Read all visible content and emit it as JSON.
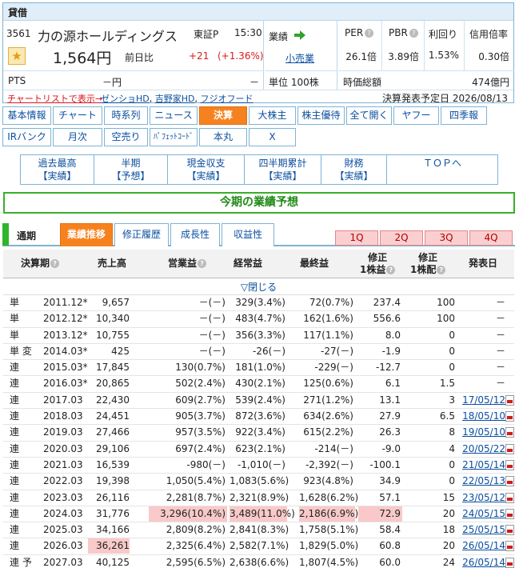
{
  "header": {
    "tag": "貸借",
    "code": "3561",
    "name": "力の源ホールディングス",
    "market": "東証P",
    "time": "15:30",
    "price": "1,564円",
    "diff_label": "前日比",
    "diff_value": "+21",
    "diff_pct": "(+1.36%)",
    "pts_label": "PTS",
    "pts_value": "－円",
    "pts_change": "－",
    "gyoseki_label": "業績",
    "sector": "小売業",
    "unit": "単位 100株",
    "indicators": [
      {
        "label": "PER",
        "value": "26.1倍"
      },
      {
        "label": "PBR",
        "value": "3.89倍"
      },
      {
        "label": "利回り",
        "value": "1.53%"
      },
      {
        "label": "信用倍率",
        "value": "0.30倍"
      }
    ],
    "market_cap_label": "時価総額",
    "market_cap_value": "474億円",
    "chart_list_link": "チャートリストで表示→",
    "related": [
      "ゼンショHD",
      "吉野家HD",
      "フジオフード"
    ],
    "announce": "決算発表予定日  2026/08/13"
  },
  "nav_row1": [
    "基本情報",
    "チャート",
    "時系列",
    "ニュース",
    "決算",
    "大株主",
    "株主優待",
    "全て開く",
    "ヤフー",
    "四季報"
  ],
  "nav_row2": [
    "IRバンク",
    "月次",
    "空売り",
    "ﾊﾟﾌｪｯﾄｺｰﾄﾞ",
    "本丸",
    "X"
  ],
  "submenu": [
    {
      "top": "過去最高",
      "bottom": "【実績】"
    },
    {
      "top": "半期",
      "bottom": "【予想】"
    },
    {
      "top": "現金収支",
      "bottom": "【実績】"
    },
    {
      "top": "四半期累計",
      "bottom": "【実績】"
    },
    {
      "top": "財務",
      "bottom": "【実績】"
    },
    {
      "top": "ＴＯＰへ",
      "bottom": ""
    }
  ],
  "section_title": "今期の業績予想",
  "tabs": {
    "period_label": "通期",
    "items": [
      "業績推移",
      "修正履歴",
      "成長性",
      "収益性"
    ],
    "quarters": [
      "1Q",
      "2Q",
      "3Q",
      "4Q"
    ]
  },
  "table": {
    "headers": {
      "period": "決算期",
      "sales": "売上高",
      "op": "営業益",
      "ord": "経常益",
      "net": "最終益",
      "eps1": "修正",
      "eps2": "1株益",
      "div1": "修正",
      "div2": "1株配",
      "date": "発表日"
    },
    "toggle": "▽閉じる",
    "rows": [
      {
        "kind": "単",
        "period": "2011.12*",
        "sales": "9,657",
        "op": "－(－)",
        "ord": "329(3.4%)",
        "net": "72(0.7%)",
        "eps": "237.4",
        "div": "100",
        "date": "－"
      },
      {
        "kind": "単",
        "period": "2012.12*",
        "sales": "10,340",
        "op": "－(－)",
        "ord": "483(4.7%)",
        "net": "162(1.6%)",
        "eps": "556.6",
        "div": "100",
        "date": "－"
      },
      {
        "kind": "単",
        "period": "2013.12*",
        "sales": "10,755",
        "op": "－(－)",
        "ord": "356(3.3%)",
        "net": "117(1.1%)",
        "eps": "8.0",
        "div": "0",
        "date": "－"
      },
      {
        "kind": "単 変",
        "period": "2014.03*",
        "sales": "425",
        "op": "－(－)",
        "ord": "-26(－)",
        "net": "-27(－)",
        "eps": "-1.9",
        "div": "0",
        "date": "－"
      },
      {
        "kind": "連",
        "period": "2015.03*",
        "sales": "17,845",
        "op": "130(0.7%)",
        "ord": "181(1.0%)",
        "net": "-229(－)",
        "eps": "-12.7",
        "div": "0",
        "date": "－"
      },
      {
        "kind": "連",
        "period": "2016.03*",
        "sales": "20,865",
        "op": "502(2.4%)",
        "ord": "430(2.1%)",
        "net": "125(0.6%)",
        "eps": "6.1",
        "div": "1.5",
        "date": "－"
      },
      {
        "kind": "連",
        "period": "2017.03",
        "sales": "22,430",
        "op": "609(2.7%)",
        "ord": "539(2.4%)",
        "net": "271(1.2%)",
        "eps": "13.1",
        "div": "3",
        "date": "17/05/12"
      },
      {
        "kind": "連",
        "period": "2018.03",
        "sales": "24,451",
        "op": "905(3.7%)",
        "ord": "872(3.6%)",
        "net": "634(2.6%)",
        "eps": "27.9",
        "div": "6.5",
        "date": "18/05/10"
      },
      {
        "kind": "連",
        "period": "2019.03",
        "sales": "27,466",
        "op": "957(3.5%)",
        "ord": "922(3.4%)",
        "net": "615(2.2%)",
        "eps": "26.3",
        "div": "8",
        "date": "19/05/10"
      },
      {
        "kind": "連",
        "period": "2020.03",
        "sales": "29,106",
        "op": "697(2.4%)",
        "ord": "623(2.1%)",
        "net": "-214(－)",
        "eps": "-9.0",
        "div": "4",
        "date": "20/05/22"
      },
      {
        "kind": "連",
        "period": "2021.03",
        "sales": "16,539",
        "op": "-980(－)",
        "ord": "-1,010(－)",
        "net": "-2,392(－)",
        "eps": "-100.1",
        "div": "0",
        "date": "21/05/14"
      },
      {
        "kind": "連",
        "period": "2022.03",
        "sales": "19,398",
        "op": "1,050(5.4%)",
        "ord": "1,083(5.6%)",
        "net": "923(4.8%)",
        "eps": "34.9",
        "div": "0",
        "date": "22/05/13"
      },
      {
        "kind": "連",
        "period": "2023.03",
        "sales": "26,116",
        "op": "2,281(8.7%)",
        "ord": "2,321(8.9%)",
        "net": "1,628(6.2%)",
        "eps": "57.1",
        "div": "15",
        "date": "23/05/12"
      },
      {
        "kind": "連",
        "period": "2024.03",
        "sales": "31,776",
        "op": "3,296(10.4%)",
        "ord": "3,489(11.0%)",
        "net": "2,186(6.9%)",
        "eps": "72.9",
        "div": "20",
        "date": "24/05/15",
        "hl": [
          "op",
          "ord",
          "net",
          "eps"
        ]
      },
      {
        "kind": "連",
        "period": "2025.03",
        "sales": "34,166",
        "op": "2,809(8.2%)",
        "ord": "2,841(8.3%)",
        "net": "1,758(5.1%)",
        "eps": "58.4",
        "div": "18",
        "date": "25/05/15"
      },
      {
        "kind": "連",
        "period": "2026.03",
        "sales": "36,261",
        "op": "2,325(6.4%)",
        "ord": "2,582(7.1%)",
        "net": "1,829(5.0%)",
        "eps": "60.8",
        "div": "20",
        "date": "26/05/14",
        "hl": [
          "sales"
        ]
      },
      {
        "kind": "連 予",
        "period": "2027.03",
        "sales": "40,125",
        "op": "2,595(6.5%)",
        "ord": "2,638(6.6%)",
        "net": "1,807(4.5%)",
        "eps": "60.0",
        "div": "24",
        "date": "26/05/14"
      }
    ]
  },
  "colors": {
    "accent": "#f6821f",
    "link": "#0b4fa0",
    "up": "#d81b1b",
    "section_green": "#3aaf2a",
    "highlight": "#f9c9c9"
  }
}
